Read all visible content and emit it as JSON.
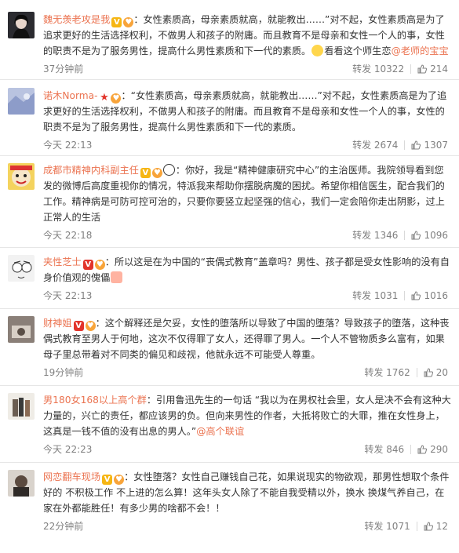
{
  "top_fragment": "",
  "forward_label": "转发",
  "comments": [
    {
      "username": "魏无羡老攻是我",
      "badges": [
        "V",
        "G"
      ],
      "text_before_emoji": "：女性素质高，母亲素质就高，就能教出……”对不起，女性素质高是为了追求更好的生活选择权利，不做男人和孩子的附庸。而且教育不是母亲和女性一个人的事，女性的职责不是为了服务男性，提高什么男性素质和下一代的素质。",
      "emoji": "smile",
      "text_after_emoji": "看看这个师生恋",
      "link": "@老师的宝宝",
      "time": "37分钟前",
      "forwards": "10322",
      "likes": "214"
    },
    {
      "username": "诺木Norma-",
      "badges": [
        "STAR",
        "G"
      ],
      "text_before_emoji": "：“女性素质高，母亲素质就高，就能教出……”对不起，女性素质高是为了追求更好的生活选择权利，不做男人和孩子的附庸。而且教育不是母亲和女性一个人的事，女性的职责不是为了服务男性，提高什么男性素质和下一代的素质。",
      "emoji": "",
      "text_after_emoji": "",
      "link": "",
      "time": "今天 22:13",
      "forwards": "2674",
      "likes": "1307"
    },
    {
      "username": "成都市精神内科副主任",
      "badges": [
        "V",
        "G"
      ],
      "text_before_emoji": "",
      "emoji": "panda",
      "text_after_emoji": "：你好，我是“精神健康研究中心”的主治医师。我院领导看到您发的微博后高度重视你的情况，特派我来帮助你摆脱病魔的困扰。希望你相信医生，配合我们的工作。精神病是可防可控可治的，只要你要竖立起坚强的信心，我们一定会陪你走出阴影，过上正常人的生活",
      "link": "",
      "time": "今天 22:18",
      "forwards": "1346",
      "likes": "1096"
    },
    {
      "username": "夹性芝士",
      "badges": [
        "VR",
        "G"
      ],
      "text_before_emoji": "：所以这是在为中国的“丧偶式教育”盖章吗？男性、孩子都是受女性影响的没有自身价值观的傀儡",
      "emoji": "hug",
      "text_after_emoji": "",
      "link": "",
      "time": "今天 22:13",
      "forwards": "1031",
      "likes": "1016"
    },
    {
      "username": "财神姐",
      "badges": [
        "VR",
        "G"
      ],
      "text_before_emoji": "：这个解释还是欠妥，女性的堕落所以导致了中国的堕落？导致孩子的堕落，这种丧偶式教育至男人于何地，这次不仅得罪了女人，还得罪了男人。一个人不管物质多么富有，如果母子里总带着对不同类的偏见和歧视，他就永远不可能受人尊重。",
      "emoji": "",
      "text_after_emoji": "",
      "link": "",
      "time": "19分钟前",
      "forwards": "1762",
      "likes": "20"
    },
    {
      "username": "男180女168以上高个群",
      "badges": [],
      "text_before_emoji": "：引用鲁迅先生的一句话 “我以为在男权社会里，女人是决不会有这种大力量的，兴亡的责任，都应该男的负。但向来男性的作者，大抵将败亡的大罪，推在女性身上，这真是一钱不值的没有出息的男人。”",
      "emoji": "",
      "text_after_emoji": "",
      "link": "@高个联谊",
      "time": "今天 22:23",
      "forwards": "846",
      "likes": "290"
    },
    {
      "username": "网恋翻车现场",
      "badges": [
        "V",
        "G"
      ],
      "text_before_emoji": "：女性堕落？女性自己赚钱自己花，如果说现实的物欲观，那男性想取个条件好的 不积极工作 不上进的怎么算！这年头女人除了不能自我受精以外，换水 换煤气养自己，在家在外都能胜任！有多少男的啥都不会！！",
      "emoji": "",
      "text_after_emoji": "",
      "link": "",
      "time": "22分钟前",
      "forwards": "1071",
      "likes": "12"
    }
  ]
}
